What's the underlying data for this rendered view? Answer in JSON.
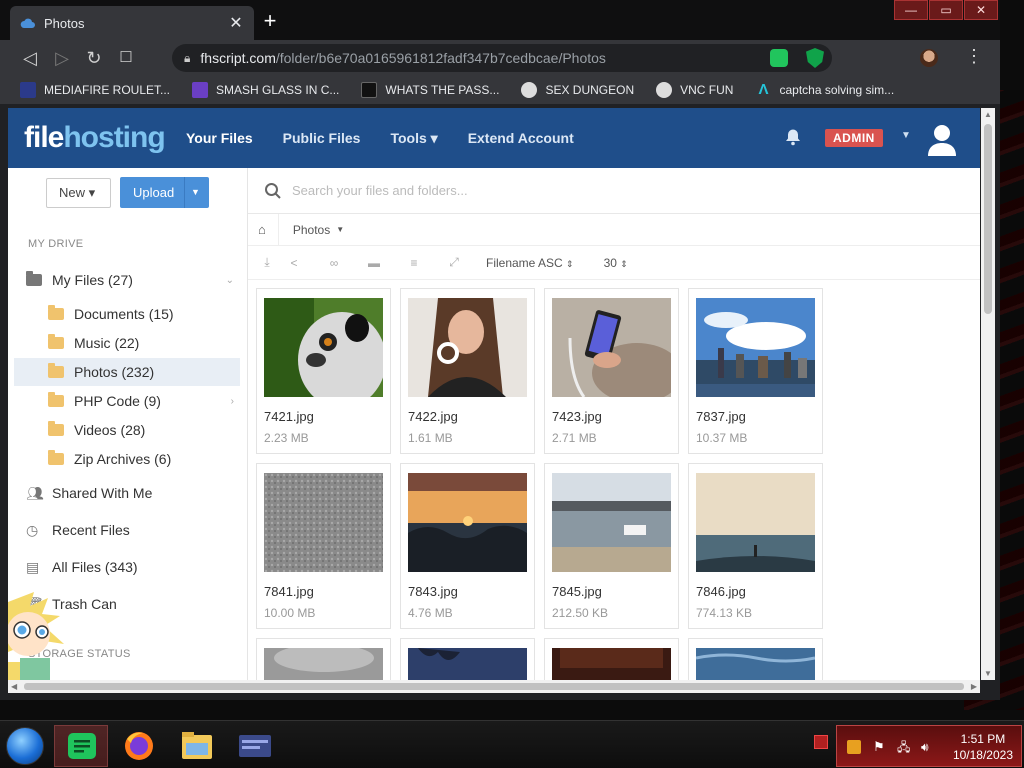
{
  "browser": {
    "tab_title": "Photos",
    "url_host": "fhscript.com",
    "url_path": "/folder/b6e70a0165961812fadf347b7cedbcae/Photos",
    "bookmarks": [
      {
        "label": "MEDIAFIRE ROULET...",
        "icon": "mediafire-icon",
        "color": "#2b3a8a"
      },
      {
        "label": "SMASH GLASS IN C...",
        "icon": "visual-studio-icon",
        "color": "#6b3fc4"
      },
      {
        "label": "WHATS THE PASS...",
        "icon": "terminal-icon",
        "color": "#111111"
      },
      {
        "label": "SEX DUNGEON",
        "icon": "gear-bookmark-icon",
        "color": "#dddddd"
      },
      {
        "label": "VNC FUN",
        "icon": "gear-bookmark-icon",
        "color": "#dddddd"
      },
      {
        "label": "captcha solving sim...",
        "icon": "lambda-icon",
        "color": "#25c5d9"
      }
    ]
  },
  "header": {
    "logo_part1": "file",
    "logo_part2": "hosting",
    "nav": [
      {
        "label": "Your Files",
        "active": true
      },
      {
        "label": "Public Files",
        "active": false
      },
      {
        "label": "Tools ▾",
        "active": false
      },
      {
        "label": "Extend Account",
        "active": false
      }
    ],
    "badge": "ADMIN"
  },
  "sidebar": {
    "new_label": "New ▾",
    "upload_label": "Upload",
    "section_drive": "MY DRIVE",
    "section_storage": "STORAGE STATUS",
    "items": [
      {
        "label": "My Files (27)",
        "icon": "folder-icon",
        "level": 0
      },
      {
        "label": "Documents (15)",
        "icon": "folder-icon",
        "level": 1
      },
      {
        "label": "Music (22)",
        "icon": "folder-icon",
        "level": 1
      },
      {
        "label": "Photos (232)",
        "icon": "folder-icon",
        "level": 1,
        "selected": true
      },
      {
        "label": "PHP Code (9)",
        "icon": "folder-icon",
        "level": 1
      },
      {
        "label": "Videos (28)",
        "icon": "folder-icon",
        "level": 1
      },
      {
        "label": "Zip Archives (6)",
        "icon": "folder-icon",
        "level": 1
      },
      {
        "label": "Shared With Me",
        "icon": "users-icon",
        "level": 0
      },
      {
        "label": "Recent Files",
        "icon": "clock-icon",
        "level": 0
      },
      {
        "label": "All Files (343)",
        "icon": "files-icon",
        "level": 0
      },
      {
        "label": "Trash Can",
        "icon": "trash-icon",
        "level": 0
      }
    ]
  },
  "main": {
    "search_placeholder": "Search your files and folders...",
    "breadcrumb": "Photos",
    "sort": "Filename ASC",
    "per_page": "30",
    "files": [
      {
        "name": "7421.jpg",
        "size": "2.23 MB",
        "thumb": "lemur"
      },
      {
        "name": "7422.jpg",
        "size": "1.61 MB",
        "thumb": "portrait"
      },
      {
        "name": "7423.jpg",
        "size": "2.71 MB",
        "thumb": "phone"
      },
      {
        "name": "7837.jpg",
        "size": "10.37 MB",
        "thumb": "skyline"
      },
      {
        "name": "7841.jpg",
        "size": "10.00 MB",
        "thumb": "texture"
      },
      {
        "name": "7843.jpg",
        "size": "4.76 MB",
        "thumb": "sunset"
      },
      {
        "name": "7845.jpg",
        "size": "212.50 KB",
        "thumb": "harbor"
      },
      {
        "name": "7846.jpg",
        "size": "774.13 KB",
        "thumb": "sea"
      },
      {
        "name": "",
        "size": "",
        "thumb": "gray"
      },
      {
        "name": "",
        "size": "",
        "thumb": "night"
      },
      {
        "name": "",
        "size": "",
        "thumb": "dark"
      },
      {
        "name": "",
        "size": "",
        "thumb": "ocean"
      }
    ]
  },
  "taskbar": {
    "time": "1:51 PM",
    "date": "10/18/2023"
  }
}
